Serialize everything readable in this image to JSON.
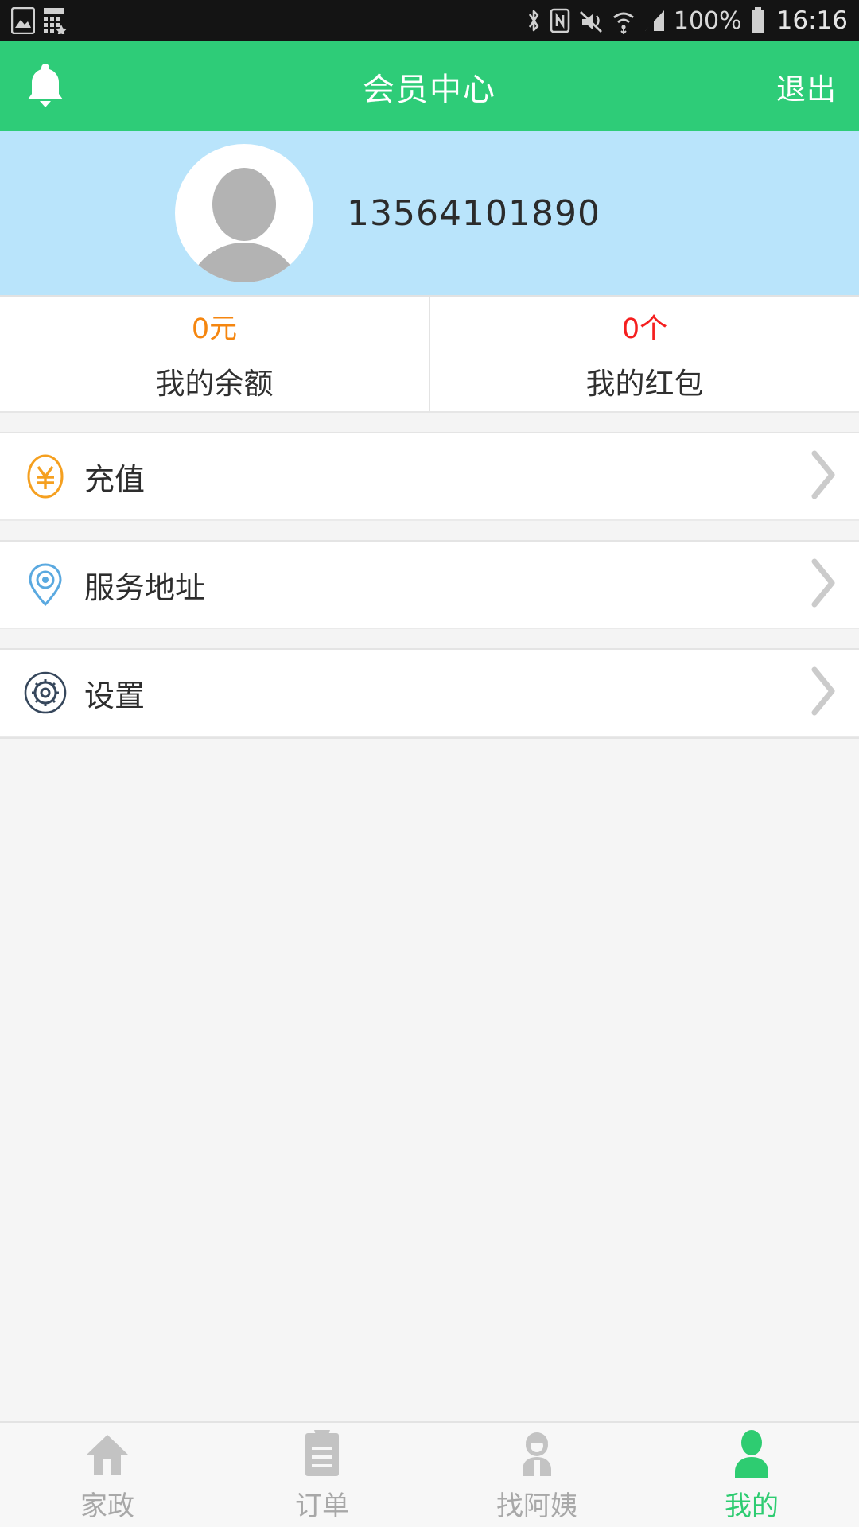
{
  "statusbar": {
    "left_icons": [
      "image-icon",
      "calculator-star-icon"
    ],
    "right_icons": [
      "bluetooth-icon",
      "nfc-icon",
      "mute-vibrate-icon",
      "wifi-icon",
      "cellular-signal-icon"
    ],
    "battery_percent": "100%",
    "time": "16:16",
    "background": "#141414",
    "foreground": "#d6d6d6"
  },
  "header": {
    "title": "会员中心",
    "bell_icon": "bell-icon",
    "logout_label": "退出",
    "background": "#2ecc78",
    "text_color": "#ffffff"
  },
  "profile": {
    "avatar_icon": "default-avatar-icon",
    "phone_number": "13564101890",
    "background": "#b9e4fb"
  },
  "stats": [
    {
      "value": "0元",
      "label": "我的余额",
      "value_color": "#f5860f",
      "name": "balance"
    },
    {
      "value": "0个",
      "label": "我的红包",
      "value_color": "#f51f1f",
      "name": "red-packet"
    }
  ],
  "menu": [
    {
      "label": "充值",
      "icon": "yuan-circle-icon",
      "color": "#f5a020"
    },
    {
      "label": "服务地址",
      "icon": "location-pin-icon",
      "color": "#5aa9e0"
    },
    {
      "label": "设置",
      "icon": "gear-circle-icon",
      "color": "#36475c"
    }
  ],
  "tabs": [
    {
      "label": "家政",
      "icon": "home-icon",
      "active": false
    },
    {
      "label": "订单",
      "icon": "clipboard-icon",
      "active": false
    },
    {
      "label": "找阿姨",
      "icon": "maid-person-icon",
      "active": false
    },
    {
      "label": "我的",
      "icon": "person-icon",
      "active": true
    }
  ],
  "colors": {
    "accent_green": "#2ecc71",
    "inactive_gray": "#c3c3c3",
    "chevron_gray": "#cbcbcb"
  }
}
